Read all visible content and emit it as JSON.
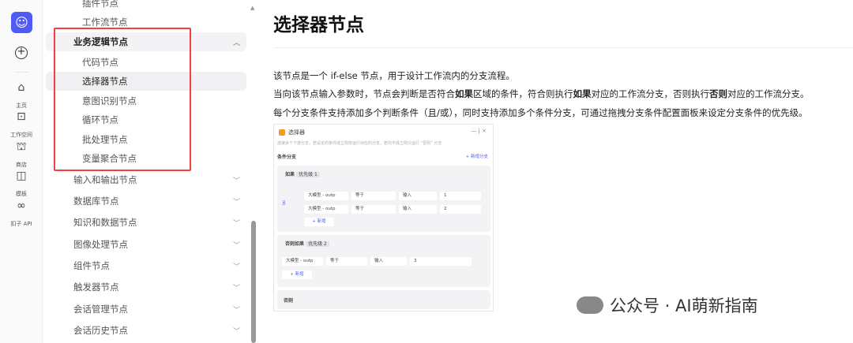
{
  "rail": {
    "items": [
      {
        "icon": "home-icon",
        "glyph": "⌂",
        "label": "主页"
      },
      {
        "icon": "terminal-icon",
        "glyph": "⊡",
        "label": "工作空间"
      },
      {
        "icon": "store-icon",
        "glyph": "⛫",
        "label": "商店"
      },
      {
        "icon": "template-icon",
        "glyph": "◫",
        "label": "模板"
      },
      {
        "icon": "link-icon",
        "glyph": "∞",
        "label": "扣子 API"
      }
    ]
  },
  "nav": {
    "items": [
      "插件节点",
      "工作流节点",
      "业务逻辑节点",
      "代码节点",
      "选择器节点",
      "意图识别节点",
      "循环节点",
      "批处理节点",
      "变量聚合节点",
      "输入和输出节点",
      "数据库节点",
      "知识和数据节点",
      "图像处理节点",
      "组件节点",
      "触发器节点",
      "会话管理节点",
      "会话历史节点"
    ]
  },
  "content": {
    "title": "选择器节点",
    "p1": "该节点是一个 if-else 节点，用于设计工作流内的分支流程。",
    "p2a": "当向该节点输入参数时，节点会判断是否符合",
    "p2b": "如果",
    "p2c": "区域的条件，符合则执行",
    "p2d": "如果",
    "p2e": "对应的工作流分支，否则执行",
    "p2f": "否则",
    "p2g": "对应的工作流分支。",
    "p3": "每个分支条件支持添加多个判断条件（且/或），同时支持添加多个条件分支，可通过拖拽分支条件配置面板来设定分支条件的优先级。"
  },
  "screenshot": {
    "title": "选择器",
    "desc": "连接多个下游分支，若设定的条件成立则仅运行对应的分支，若均不成立则只运行 “否则” 分支",
    "section": "条件分支",
    "add_branch": "+ 新增分支",
    "if": "如果",
    "if_priority": "优先级 1",
    "elseif": "否则如果",
    "elseif_priority": "优先级 2",
    "else": "否则",
    "logic": "且",
    "var": "大模型 - outp",
    "op": "等于",
    "type": "输入",
    "values": [
      "1",
      "2",
      "3"
    ],
    "add": "+ 新增"
  },
  "watermark": "公众号 · AI萌新指南"
}
